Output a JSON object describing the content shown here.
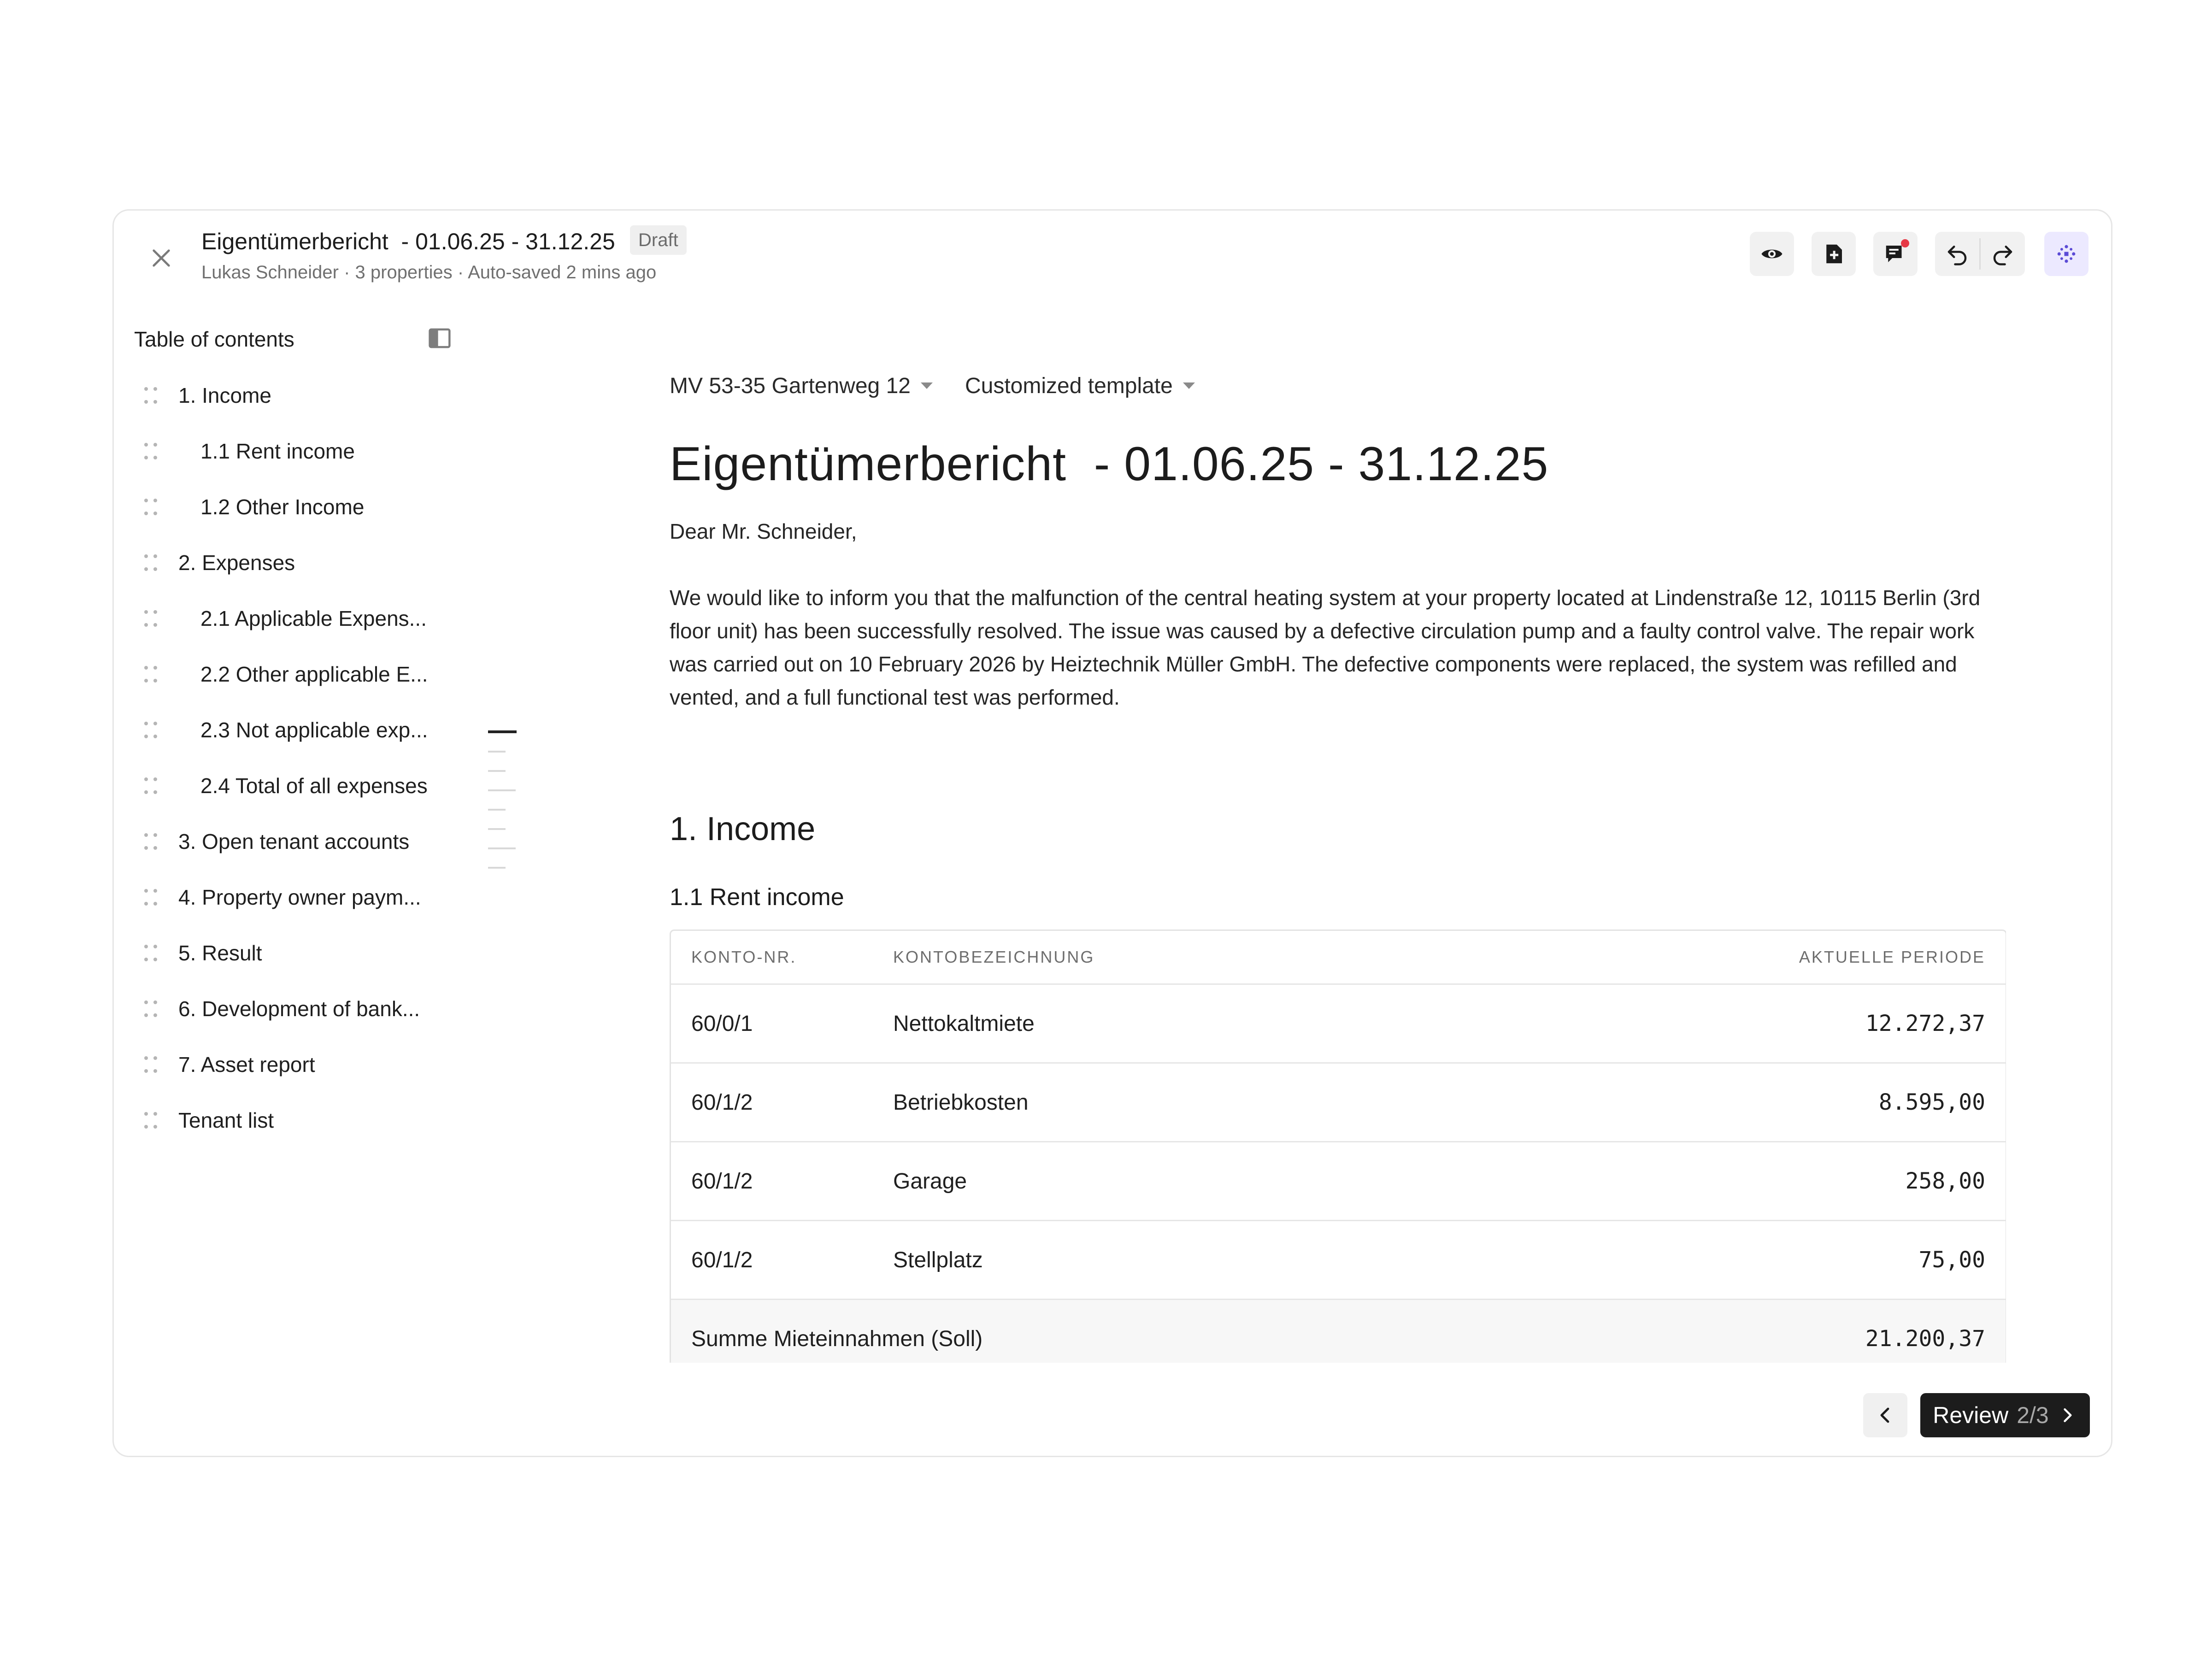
{
  "header": {
    "title": "Eigentümerbericht  - 01.06.25 - 31.12.25",
    "badge": "Draft",
    "meta": "Lukas Schneider · 3 properties · Auto-saved 2 mins ago"
  },
  "toolbar": {
    "preview_icon": "eye-icon",
    "add_icon": "add-page-icon",
    "comments_icon": "comment-icon",
    "undo_icon": "undo-icon",
    "redo_icon": "redo-icon",
    "ai_icon": "sparkle-icon"
  },
  "toc": {
    "title": "Table of contents",
    "items": [
      {
        "label": "1. Income",
        "level": 1
      },
      {
        "label": "1.1 Rent income",
        "level": 2
      },
      {
        "label": "1.2 Other Income",
        "level": 2
      },
      {
        "label": "2. Expenses",
        "level": 1
      },
      {
        "label": "2.1 Applicable Expens...",
        "level": 2
      },
      {
        "label": "2.2 Other applicable E...",
        "level": 2
      },
      {
        "label": "2.3 Not applicable exp...",
        "level": 2
      },
      {
        "label": "2.4 Total of all expenses",
        "level": 2
      },
      {
        "label": "3. Open tenant accounts",
        "level": 1
      },
      {
        "label": "4. Property owner paym...",
        "level": 1
      },
      {
        "label": "5. Result",
        "level": 1
      },
      {
        "label": "6. Development of bank...",
        "level": 1
      },
      {
        "label": "7. Asset report",
        "level": 1
      },
      {
        "label": "Tenant list",
        "level": 1
      }
    ]
  },
  "document": {
    "property_selector": "MV 53-35 Gartenweg 12",
    "template_selector": "Customized template",
    "heading": "Eigentümerbericht  - 01.06.25 - 31.12.25",
    "salutation": "Dear Mr. Schneider,",
    "body": "We would like to inform you that the malfunction of the central heating system at your property located at Lindenstraße 12, 10115 Berlin (3rd floor unit) has been successfully resolved. The issue was caused by a defective circulation pump and a faulty control valve. The repair work was carried out on 10 February 2026 by Heiztechnik Müller GmbH. The defective components were replaced, the system was refilled and vented, and a full functional test was performed.",
    "section_heading": "1. Income",
    "subsection_heading": "1.1 Rent income",
    "table": {
      "headers": [
        "KONTO-NR.",
        "KONTOBEZEICHNUNG",
        "AKTUELLE PERIODE"
      ],
      "rows": [
        {
          "konto": "60/0/1",
          "bezeichnung": "Nettokaltmiete",
          "betrag": "12.272,37"
        },
        {
          "konto": "60/1/2",
          "bezeichnung": "Betriebkosten",
          "betrag": "8.595,00"
        },
        {
          "konto": "60/1/2",
          "bezeichnung": "Garage",
          "betrag": "258,00"
        },
        {
          "konto": "60/1/2",
          "bezeichnung": "Stellplatz",
          "betrag": "75,00"
        }
      ],
      "sum_label": "Summe Mieteinnahmen (Soll)",
      "sum_value": "21.200,37"
    }
  },
  "footer": {
    "review_label": "Review",
    "review_count": "2/3"
  }
}
